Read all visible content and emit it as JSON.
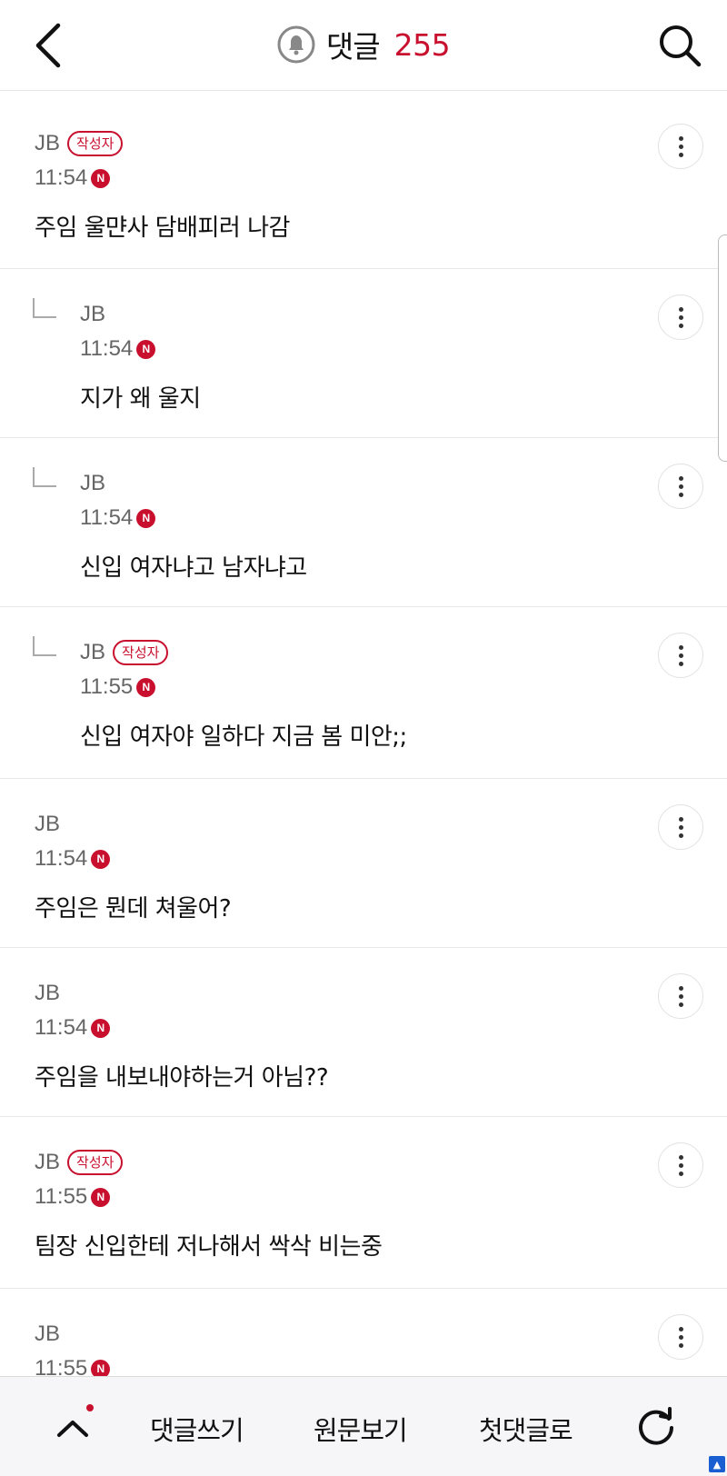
{
  "header": {
    "title": "댓글",
    "count": "255",
    "accent_color": "#c8102e",
    "back_icon": "chevron-left-icon",
    "bell_icon": "bell-icon",
    "search_icon": "search-icon"
  },
  "comments": [
    {
      "author": "JB",
      "badge": "작성자",
      "time": "11:54",
      "new_mark": "N",
      "text": "주임 울먄사 담배피러 나감",
      "reply": false
    },
    {
      "author": "JB",
      "badge": "",
      "time": "11:54",
      "new_mark": "N",
      "text": "지가 왜 울지",
      "reply": true
    },
    {
      "author": "JB",
      "badge": "",
      "time": "11:54",
      "new_mark": "N",
      "text": "신입 여자냐고 남자냐고",
      "reply": true
    },
    {
      "author": "JB",
      "badge": "작성자",
      "time": "11:55",
      "new_mark": "N",
      "text": "신입 여자야 일하다 지금 봄 미안;;",
      "reply": true
    },
    {
      "author": "JB",
      "badge": "",
      "time": "11:54",
      "new_mark": "N",
      "text": "주임은 뭔데 쳐울어?",
      "reply": false
    },
    {
      "author": "JB",
      "badge": "",
      "time": "11:54",
      "new_mark": "N",
      "text": "주임을 내보내야하는거 아님??",
      "reply": false
    },
    {
      "author": "JB",
      "badge": "작성자",
      "time": "11:55",
      "new_mark": "N",
      "text": "팀장 신입한테 저나해서 싹삭 비는중",
      "reply": false
    },
    {
      "author": "JB",
      "badge": "",
      "time": "11:55",
      "new_mark": "N",
      "text": "",
      "reply": false
    }
  ],
  "bottom_bar": {
    "write_label": "댓글쓰기",
    "original_label": "원문보기",
    "first_label": "첫댓글로",
    "up_icon": "chevron-up-icon",
    "refresh_icon": "refresh-icon"
  }
}
